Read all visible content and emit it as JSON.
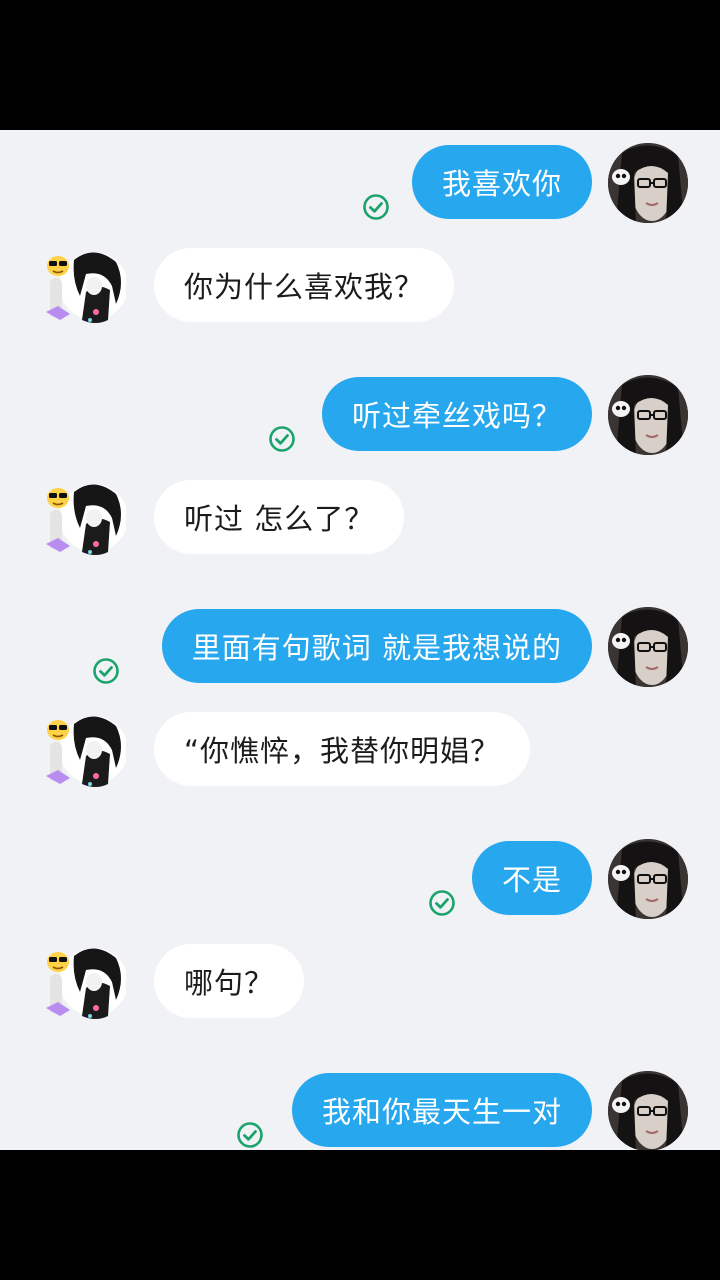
{
  "messages": [
    {
      "dir": "out",
      "text": "我喜欢你"
    },
    {
      "dir": "in",
      "text": "你为什么喜欢我？"
    },
    {
      "dir": "out",
      "text": "听过牵丝戏吗？"
    },
    {
      "dir": "in",
      "text": "听过 怎么了？"
    },
    {
      "dir": "out",
      "text": "里面有句歌词  就是我想说的"
    },
    {
      "dir": "in",
      "text": "“你憔悴，我替你明娼？"
    },
    {
      "dir": "out",
      "text": "不是"
    },
    {
      "dir": "in",
      "text": "哪句？"
    },
    {
      "dir": "out",
      "text": "我和你最天生一对"
    }
  ],
  "colors": {
    "sent_bubble": "#27a7ee",
    "received_bubble": "#ffffff",
    "read_check": "#1aa36b",
    "chat_background": "#f1f2f6"
  },
  "icons": {
    "read_receipt": "check-circle-icon",
    "self_avatar": "user-avatar-girl",
    "contact_avatar": "contact-avatar-boy"
  }
}
